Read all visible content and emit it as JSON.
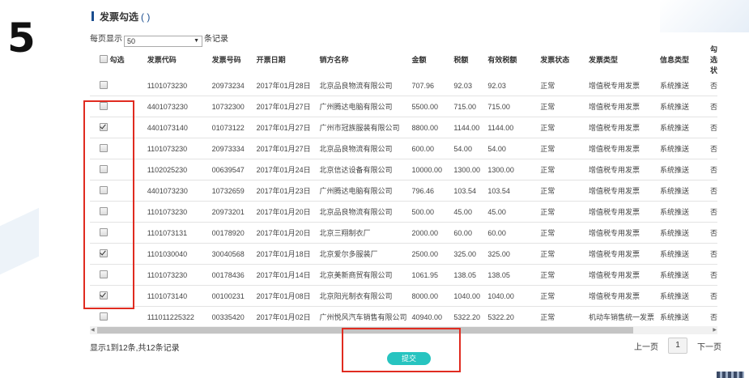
{
  "step_number": "5",
  "panel": {
    "title": "发票勾选",
    "title_paren": "( )"
  },
  "page_size": {
    "prefix": "每页显示",
    "value": "50",
    "suffix": "条记录"
  },
  "columns": [
    "勾选",
    "发票代码",
    "发票号码",
    "开票日期",
    "销方名称",
    "金额",
    "税额",
    "有效税额",
    "发票状态",
    "发票类型",
    "信息类型",
    "勾选状"
  ],
  "rows": [
    {
      "checked": false,
      "code": "1101073230",
      "number": "20973234",
      "date": "2017年01月28日",
      "seller": "北京品良物流有限公司",
      "amount": "707.96",
      "tax": "92.03",
      "valid_tax": "92.03",
      "status": "正常",
      "type": "增值税专用发票",
      "info": "系统推送",
      "sel": "否"
    },
    {
      "checked": false,
      "code": "4401073230",
      "number": "10732300",
      "date": "2017年01月27日",
      "seller": "广州腾达电脑有限公司",
      "amount": "5500.00",
      "tax": "715.00",
      "valid_tax": "715.00",
      "status": "正常",
      "type": "增值税专用发票",
      "info": "系统推送",
      "sel": "否"
    },
    {
      "checked": true,
      "code": "4401073140",
      "number": "01073122",
      "date": "2017年01月27日",
      "seller": "广州市冠族服装有限公司",
      "amount": "8800.00",
      "tax": "1144.00",
      "valid_tax": "1144.00",
      "status": "正常",
      "type": "增值税专用发票",
      "info": "系统推送",
      "sel": "否"
    },
    {
      "checked": false,
      "code": "1101073230",
      "number": "20973334",
      "date": "2017年01月27日",
      "seller": "北京品良物流有限公司",
      "amount": "600.00",
      "tax": "54.00",
      "valid_tax": "54.00",
      "status": "正常",
      "type": "增值税专用发票",
      "info": "系统推送",
      "sel": "否"
    },
    {
      "checked": false,
      "code": "1102025230",
      "number": "00639547",
      "date": "2017年01月24日",
      "seller": "北京信达设备有限公司",
      "amount": "10000.00",
      "tax": "1300.00",
      "valid_tax": "1300.00",
      "status": "正常",
      "type": "增值税专用发票",
      "info": "系统推送",
      "sel": "否"
    },
    {
      "checked": false,
      "code": "4401073230",
      "number": "10732659",
      "date": "2017年01月23日",
      "seller": "广州腾达电脑有限公司",
      "amount": "796.46",
      "tax": "103.54",
      "valid_tax": "103.54",
      "status": "正常",
      "type": "增值税专用发票",
      "info": "系统推送",
      "sel": "否"
    },
    {
      "checked": false,
      "code": "1101073230",
      "number": "20973201",
      "date": "2017年01月20日",
      "seller": "北京品良物流有限公司",
      "amount": "500.00",
      "tax": "45.00",
      "valid_tax": "45.00",
      "status": "正常",
      "type": "增值税专用发票",
      "info": "系统推送",
      "sel": "否"
    },
    {
      "checked": false,
      "code": "1101073131",
      "number": "00178920",
      "date": "2017年01月20日",
      "seller": "北京三翔制衣厂",
      "amount": "2000.00",
      "tax": "60.00",
      "valid_tax": "60.00",
      "status": "正常",
      "type": "增值税专用发票",
      "info": "系统推送",
      "sel": "否"
    },
    {
      "checked": true,
      "code": "1101030040",
      "number": "30040568",
      "date": "2017年01月18日",
      "seller": "北京爱尔多服装厂",
      "amount": "2500.00",
      "tax": "325.00",
      "valid_tax": "325.00",
      "status": "正常",
      "type": "增值税专用发票",
      "info": "系统推送",
      "sel": "否"
    },
    {
      "checked": false,
      "code": "1101073230",
      "number": "00178436",
      "date": "2017年01月14日",
      "seller": "北京美新商贸有限公司",
      "amount": "1061.95",
      "tax": "138.05",
      "valid_tax": "138.05",
      "status": "正常",
      "type": "增值税专用发票",
      "info": "系统推送",
      "sel": "否"
    },
    {
      "checked": true,
      "code": "1101073140",
      "number": "00100231",
      "date": "2017年01月08日",
      "seller": "北京阳光制衣有限公司",
      "amount": "8000.00",
      "tax": "1040.00",
      "valid_tax": "1040.00",
      "status": "正常",
      "type": "增值税专用发票",
      "info": "系统推送",
      "sel": "否"
    },
    {
      "checked": false,
      "code": "111011225322",
      "number": "00335420",
      "date": "2017年01月02日",
      "seller": "广州悦风汽车销售有限公司",
      "amount": "40940.00",
      "tax": "5322.20",
      "valid_tax": "5322.20",
      "status": "正常",
      "type": "机动车销售统一发票",
      "info": "系统推送",
      "sel": "否"
    }
  ],
  "footer": {
    "info": "显示1到12条,共12条记录",
    "prev": "上一页",
    "page": "1",
    "next": "下一页"
  },
  "submit_label": "提交"
}
